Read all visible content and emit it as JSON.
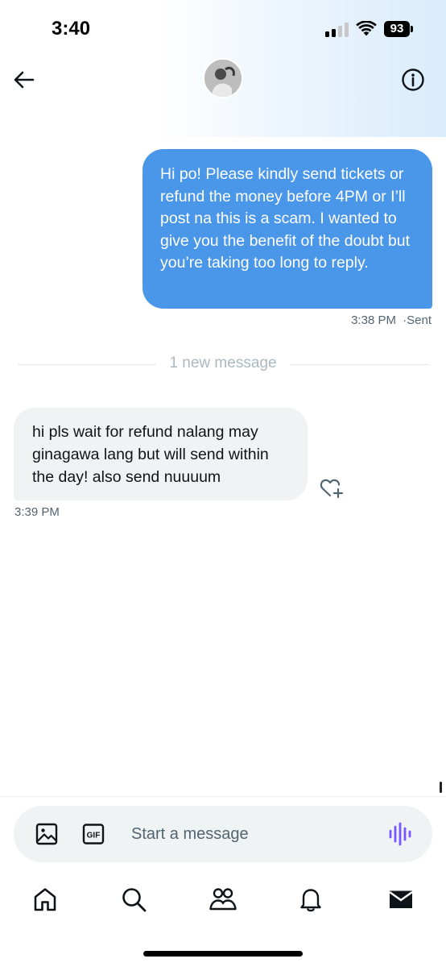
{
  "status_bar": {
    "time": "3:40",
    "battery": "93"
  },
  "header": {
    "back_icon": "arrow-left-icon",
    "info_icon": "info-circle-icon"
  },
  "conversation": {
    "sent_message": {
      "text": "Hi po! Please kindly send tickets or refund the money before 4PM or I’ll post na this is a scam. I wanted to give you the benefit of the doubt but you’re taking too long to reply.",
      "time": "3:38 PM",
      "status": "Sent",
      "color": "#4a96e8"
    },
    "divider": "1 new message",
    "received_message": {
      "text": "hi pls wait for refund nalang may ginagawa lang but will send within the day! also send nuuuum",
      "time": "3:39 PM"
    }
  },
  "composer": {
    "placeholder": "Start a message",
    "image_icon": "image-icon",
    "gif_icon": "gif-icon",
    "gif_label": "GIF",
    "voice_icon": "voice-waveform-icon",
    "voice_color": "#7856ff"
  },
  "tabs": [
    {
      "icon": "home-icon"
    },
    {
      "icon": "search-icon"
    },
    {
      "icon": "communities-icon"
    },
    {
      "icon": "notifications-icon"
    },
    {
      "icon": "messages-icon",
      "active": true
    }
  ]
}
